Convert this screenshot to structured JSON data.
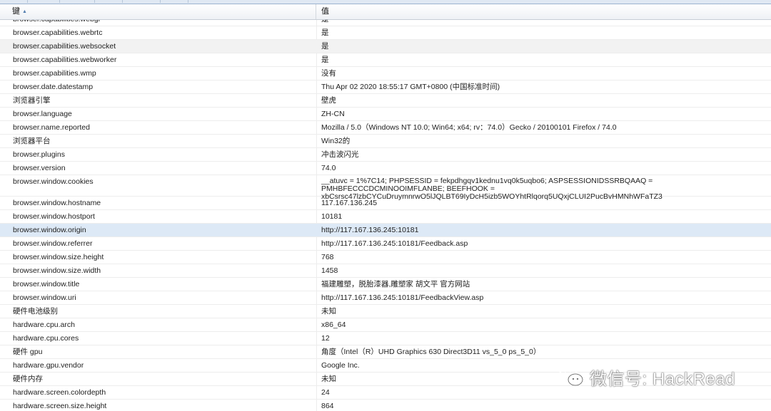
{
  "header": {
    "key_label": "键",
    "value_label": "值"
  },
  "rows": [
    {
      "k": "browser.capabilities.webgl",
      "v": "是"
    },
    {
      "k": "browser.capabilities.webrtc",
      "v": "是"
    },
    {
      "k": "browser.capabilities.websocket",
      "v": "是"
    },
    {
      "k": "browser.capabilities.webworker",
      "v": "是"
    },
    {
      "k": "browser.capabilities.wmp",
      "v": "没有"
    },
    {
      "k": "browser.date.datestamp",
      "v": "Thu Apr 02 2020 18:55:17 GMT+0800 (中国标准时间)"
    },
    {
      "k": "浏览器引擎",
      "v": "壁虎"
    },
    {
      "k": "browser.language",
      "v": "ZH-CN"
    },
    {
      "k": "browser.name.reported",
      "v": "Mozilla / 5.0（Windows NT 10.0; Win64; x64; rv：74.0）Gecko / 20100101 Firefox / 74.0"
    },
    {
      "k": "浏览器平台",
      "v": "Win32的"
    },
    {
      "k": "browser.plugins",
      "v": "冲击波闪光"
    },
    {
      "k": "browser.version",
      "v": "74.0"
    },
    {
      "k": "browser.window.cookies",
      "v": "__atuvc = 1%7C14; PHPSESSID = fekpdhgqv1kednu1vq0k5uqbo6; ASPSESSIONIDSSRBQAAQ = PMHBFECCCDCMINOOIMFLANBE; BEEFHOOK = xbCsrsc47lzbCYCuDruymnrwO5lJQLBT69IyDcH5izb5WOYhtRlqorq5UQxjCLUI2PucBvHMNhWFaTZ3"
    },
    {
      "k": "browser.window.hostname",
      "v": "117.167.136.245"
    },
    {
      "k": "browser.window.hostport",
      "v": "10181"
    },
    {
      "k": "browser.window.origin",
      "v": "http://117.167.136.245:10181"
    },
    {
      "k": "browser.window.referrer",
      "v": "http://117.167.136.245:10181/Feedback.asp"
    },
    {
      "k": "browser.window.size.height",
      "v": "768"
    },
    {
      "k": "browser.window.size.width",
      "v": "1458"
    },
    {
      "k": "browser.window.title",
      "v": "福建雕塑，脱胎漆器,雕塑家 胡文平 官方网站"
    },
    {
      "k": "browser.window.uri",
      "v": "http://117.167.136.245:10181/FeedbackView.asp"
    },
    {
      "k": "硬件电池级别",
      "v": "未知"
    },
    {
      "k": "hardware.cpu.arch",
      "v": "x86_64"
    },
    {
      "k": "hardware.cpu.cores",
      "v": "12"
    },
    {
      "k": "硬件 gpu",
      "v": "角度（Intel（R）UHD Graphics 630 Direct3D11 vs_5_0 ps_5_0）"
    },
    {
      "k": "hardware.gpu.vendor",
      "v": "Google Inc."
    },
    {
      "k": "硬件内存",
      "v": "未知"
    },
    {
      "k": "hardware.screen.colordepth",
      "v": "24"
    },
    {
      "k": "hardware.screen.size.height",
      "v": "864"
    }
  ],
  "watermark": {
    "text": "微信号: HackRead"
  }
}
